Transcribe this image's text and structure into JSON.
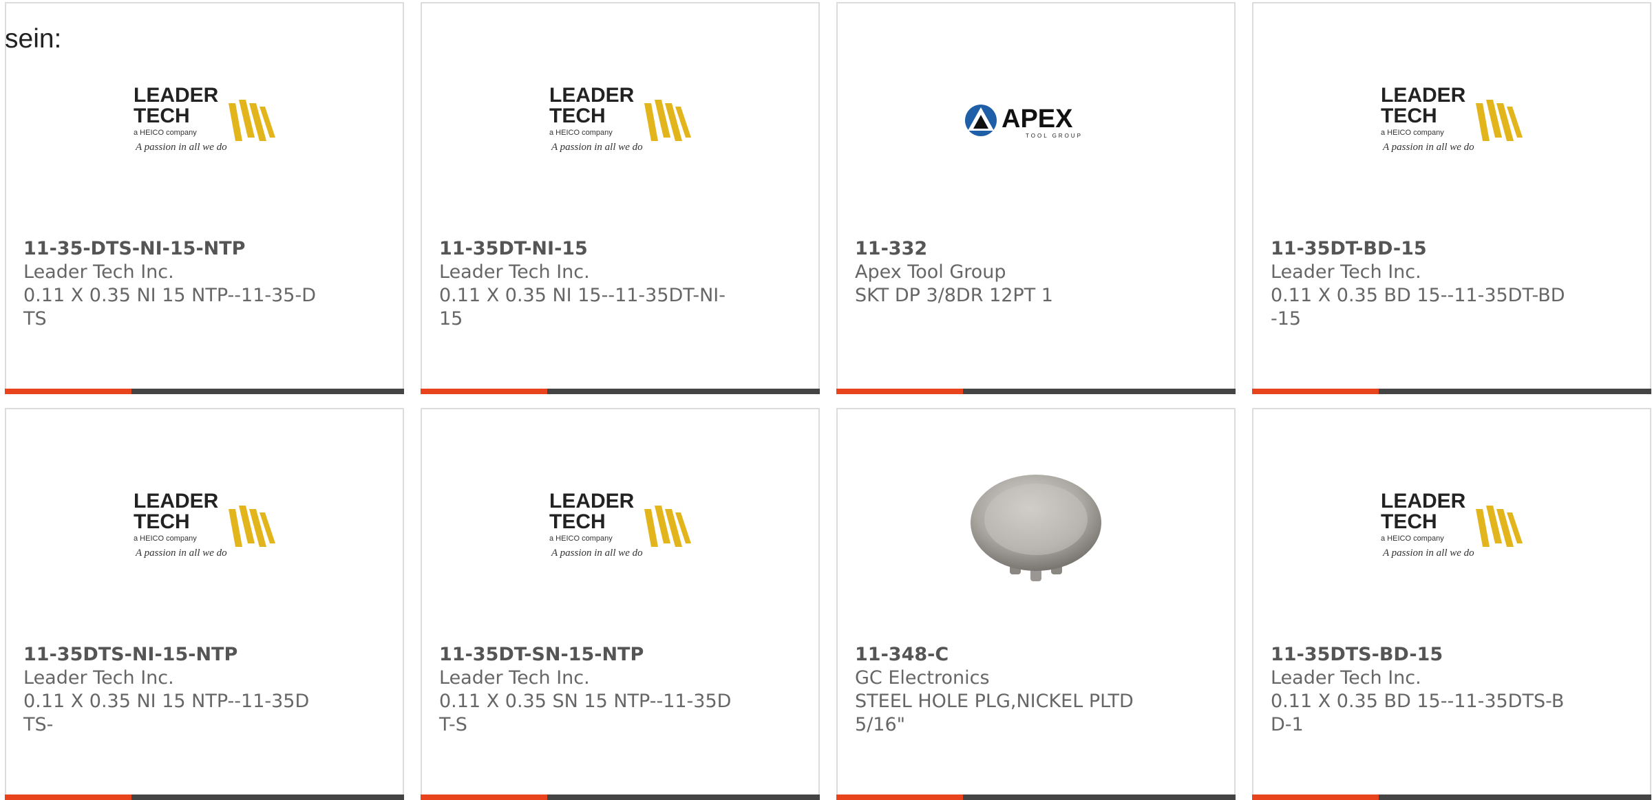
{
  "intro": "sein:",
  "colors": {
    "accent": "#e8431c",
    "bar": "#444444",
    "border": "#dcdcdc"
  },
  "brand_text": {
    "leader_line1": "LEADER",
    "leader_line2": "TECH",
    "leader_heico": "a HEICO company",
    "leader_tagline": "A passion in all we do",
    "apex_name": "APEX",
    "apex_sub": "TOOL GROUP"
  },
  "cards": [
    {
      "pn": "11-35-DTS-NI-15-NTP",
      "mfr": "Leader Tech Inc.",
      "desc": "0.11 X 0.35 NI 15 NTP--11-35-DTS",
      "image": "leader-tech-logo"
    },
    {
      "pn": "11-35DT-NI-15",
      "mfr": "Leader Tech Inc.",
      "desc": "0.11 X 0.35 NI 15--11-35DT-NI-15",
      "image": "leader-tech-logo"
    },
    {
      "pn": "11-332",
      "mfr": "Apex Tool Group",
      "desc": "SKT DP 3/8DR 12PT 1",
      "image": "apex-tool-group-logo"
    },
    {
      "pn": "11-35DT-BD-15",
      "mfr": "Leader Tech Inc.",
      "desc": "0.11 X 0.35 BD 15--11-35DT-BD-15",
      "image": "leader-tech-logo"
    },
    {
      "pn": "11-35DTS-NI-15-NTP",
      "mfr": "Leader Tech Inc.",
      "desc": "0.11 X 0.35 NI 15 NTP--11-35DTS-",
      "image": "leader-tech-logo"
    },
    {
      "pn": "11-35DT-SN-15-NTP",
      "mfr": "Leader Tech Inc.",
      "desc": "0.11 X 0.35 SN 15 NTP--11-35DT-S",
      "image": "leader-tech-logo"
    },
    {
      "pn": "11-348-C",
      "mfr": "GC Electronics",
      "desc": "STEEL HOLE PLG,NICKEL PLTD 5/16\"",
      "image": "hole-plug-photo"
    },
    {
      "pn": "11-35DTS-BD-15",
      "mfr": "Leader Tech Inc.",
      "desc": "0.11 X 0.35 BD 15--11-35DTS-BD-1",
      "image": "leader-tech-logo"
    }
  ]
}
